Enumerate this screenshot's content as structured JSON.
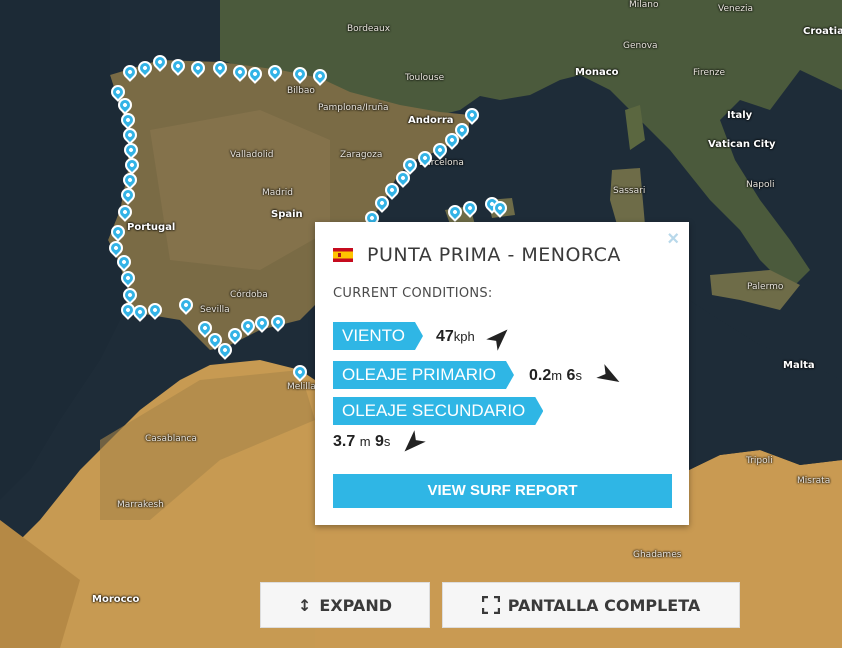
{
  "map": {
    "places": [
      {
        "id": "milano",
        "label": "Milano"
      },
      {
        "id": "venezia",
        "label": "Venezia"
      },
      {
        "id": "bordeaux",
        "label": "Bordeaux"
      },
      {
        "id": "croatia",
        "label": "Croatia"
      },
      {
        "id": "genova",
        "label": "Genova"
      },
      {
        "id": "monaco",
        "label": "Monaco"
      },
      {
        "id": "toulouse",
        "label": "Toulouse"
      },
      {
        "id": "bilbao",
        "label": "Bilbao"
      },
      {
        "id": "firenze",
        "label": "Firenze"
      },
      {
        "id": "pamplona",
        "label": "Pamplona/Iruña"
      },
      {
        "id": "andorra",
        "label": "Andorra"
      },
      {
        "id": "italy",
        "label": "Italy"
      },
      {
        "id": "vatican",
        "label": "Vatican City"
      },
      {
        "id": "zaragoza",
        "label": "Zaragoza"
      },
      {
        "id": "valladolid",
        "label": "Valladolid"
      },
      {
        "id": "barcelona",
        "label": "Barcelona"
      },
      {
        "id": "napoli",
        "label": "Napoli"
      },
      {
        "id": "sassari",
        "label": "Sassari"
      },
      {
        "id": "spain",
        "label": "Spain"
      },
      {
        "id": "portugal",
        "label": "Portugal"
      },
      {
        "id": "madrid",
        "label": "Madrid"
      },
      {
        "id": "palermo",
        "label": "Palermo"
      },
      {
        "id": "sevilla",
        "label": "Sevilla"
      },
      {
        "id": "cordoba",
        "label": "Córdoba"
      },
      {
        "id": "malta",
        "label": "Malta"
      },
      {
        "id": "melilla",
        "label": "Melilla"
      },
      {
        "id": "casablanca",
        "label": "Casablanca"
      },
      {
        "id": "marrakesh",
        "label": "Marrakesh"
      },
      {
        "id": "morocco",
        "label": "Morocco"
      },
      {
        "id": "tripoli",
        "label": "Tripoli"
      },
      {
        "id": "misrata",
        "label": "Misrata"
      },
      {
        "id": "ghadames",
        "label": "Ghadames"
      }
    ]
  },
  "popup": {
    "title": "PUNTA PRIMA - MENORCA",
    "current_conditions_label": "CURRENT CONDITIONS:",
    "close_icon": "×",
    "wind": {
      "label": "VIENTO",
      "value": "47",
      "unit": "kph",
      "direction_deg": 45
    },
    "primary_swell": {
      "label": "OLEAJE PRIMARIO",
      "height": "0.2",
      "height_unit": "m",
      "period": "6",
      "period_unit": "s",
      "direction_deg": 120
    },
    "secondary_swell": {
      "label": "OLEAJE SECUNDARIO",
      "height": "3.7",
      "height_unit": "m",
      "period": "9",
      "period_unit": "s",
      "direction_deg": -135
    },
    "report_button": "VIEW SURF REPORT"
  },
  "controls": {
    "expand_label": "EXPAND",
    "expand_icon": "↕",
    "fullscreen_label": "PANTALLA COMPLETA",
    "fullscreen_icon": "fullscreen-icon"
  },
  "colors": {
    "accent": "#2fb6e5",
    "pin": "#33b3e6"
  }
}
